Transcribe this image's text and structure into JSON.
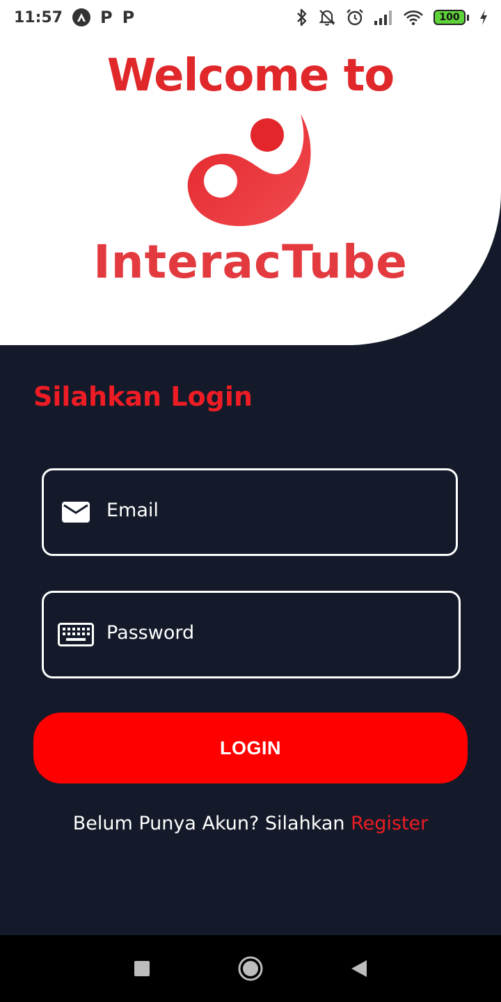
{
  "status_bar": {
    "time": "11:57",
    "notification_icons": [
      "android-studio-icon",
      "p-icon",
      "p-icon"
    ],
    "p_glyph": "P",
    "battery_level": "100",
    "system_icons": [
      "bluetooth-icon",
      "notifications-off-icon",
      "alarm-icon",
      "signal-icon",
      "wifi-icon",
      "battery-icon",
      "charging-icon"
    ]
  },
  "hero": {
    "welcome_text": "Welcome to",
    "brand_name": "InteracTube"
  },
  "login": {
    "title": "Silahkan Login",
    "email_placeholder": "Email",
    "password_placeholder": "Password",
    "login_button": "LOGIN",
    "register_prompt": "Belum Punya Akun? Silahkan ",
    "register_link": "Register"
  },
  "nav": {
    "buttons": [
      "recents-button",
      "home-button",
      "back-button"
    ]
  },
  "colors": {
    "background": "#141a29",
    "accent": "#ff0000",
    "brand_red": "#e0272a",
    "text": "#ffffff"
  }
}
